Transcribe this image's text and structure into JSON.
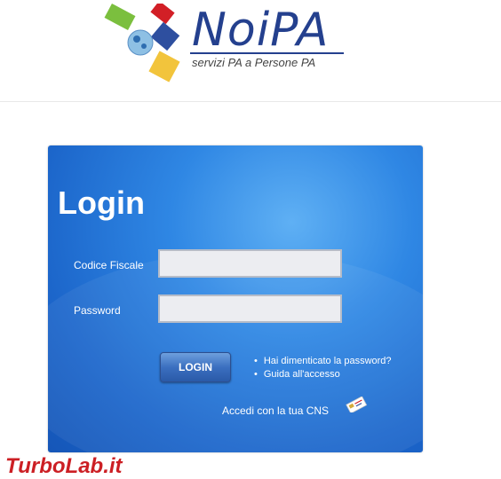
{
  "header": {
    "brand_name": "NoiPA",
    "tagline": "servizi PA a Persone PA"
  },
  "login": {
    "title": "Login",
    "codice_fiscale_label": "Codice Fiscale",
    "codice_fiscale_value": "",
    "password_label": "Password",
    "password_value": "",
    "login_button": "LOGIN",
    "links": [
      {
        "label": "Hai dimenticato la password?"
      },
      {
        "label": "Guida all'accesso"
      }
    ],
    "cns_link": "Accedi con la tua CNS"
  },
  "watermark": {
    "text": "TurboLab.it"
  },
  "colors": {
    "brand_blue": "#24408e",
    "panel_blue": "#2f87e4",
    "watermark_red": "#cc1f24"
  }
}
